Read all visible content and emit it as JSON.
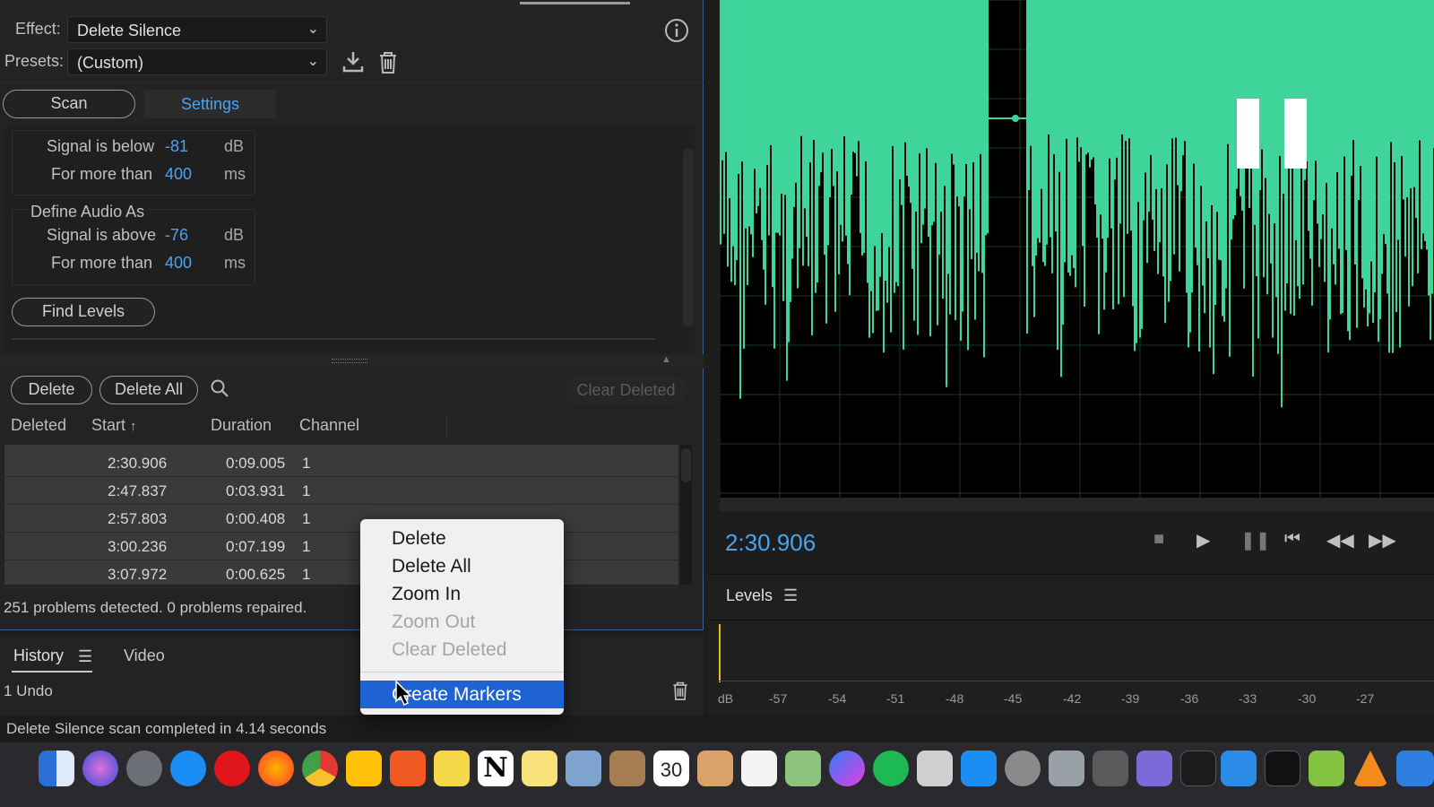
{
  "effect": {
    "label": "Effect:",
    "value": "Delete Silence"
  },
  "presets": {
    "label": "Presets:",
    "value": "(Custom)"
  },
  "tabs": {
    "scan": "Scan",
    "settings": "Settings"
  },
  "silence": {
    "row1": {
      "label": "Signal is below",
      "value": "-81",
      "unit": "dB"
    },
    "row2": {
      "label": "For more than",
      "value": "400",
      "unit": "ms"
    }
  },
  "define_audio": {
    "title": "Define Audio As",
    "row1": {
      "label": "Signal is above",
      "value": "-76",
      "unit": "dB"
    },
    "row2": {
      "label": "For more than",
      "value": "400",
      "unit": "ms"
    }
  },
  "find_levels": "Find Levels",
  "actions": {
    "delete": "Delete",
    "delete_all": "Delete All",
    "clear_deleted": "Clear Deleted"
  },
  "table": {
    "headers": [
      "Deleted",
      "Start",
      "Duration",
      "Channel"
    ],
    "rows": [
      {
        "start": "2:30.906",
        "duration": "0:09.005",
        "channel": "1"
      },
      {
        "start": "2:47.837",
        "duration": "0:03.931",
        "channel": "1"
      },
      {
        "start": "2:57.803",
        "duration": "0:00.408",
        "channel": "1"
      },
      {
        "start": "3:00.236",
        "duration": "0:07.199",
        "channel": "1"
      },
      {
        "start": "3:07.972",
        "duration": "0:00.625",
        "channel": "1"
      }
    ]
  },
  "problems": "251 problems detected. 0 problems repaired.",
  "context_menu": {
    "items": [
      "Delete",
      "Delete All",
      "Zoom In",
      "Zoom Out",
      "Clear Deleted"
    ],
    "create_markers": "Create Markers"
  },
  "history": {
    "tab_history": "History",
    "tab_video": "Video",
    "undo": "1 Undo"
  },
  "status": "Delete Silence scan completed in 4.14 seconds",
  "transport": {
    "time": "2:30.906"
  },
  "levels": {
    "label": "Levels",
    "ticks": [
      "dB",
      "-57",
      "-54",
      "-51",
      "-48",
      "-45",
      "-42",
      "-39",
      "-36",
      "-33",
      "-30",
      "-27"
    ]
  },
  "calendar": {
    "day": "30"
  },
  "colors": {
    "accent": "#4aa3f0",
    "waveform": "#3fd59a",
    "menu_highlight": "#1f62d4"
  }
}
